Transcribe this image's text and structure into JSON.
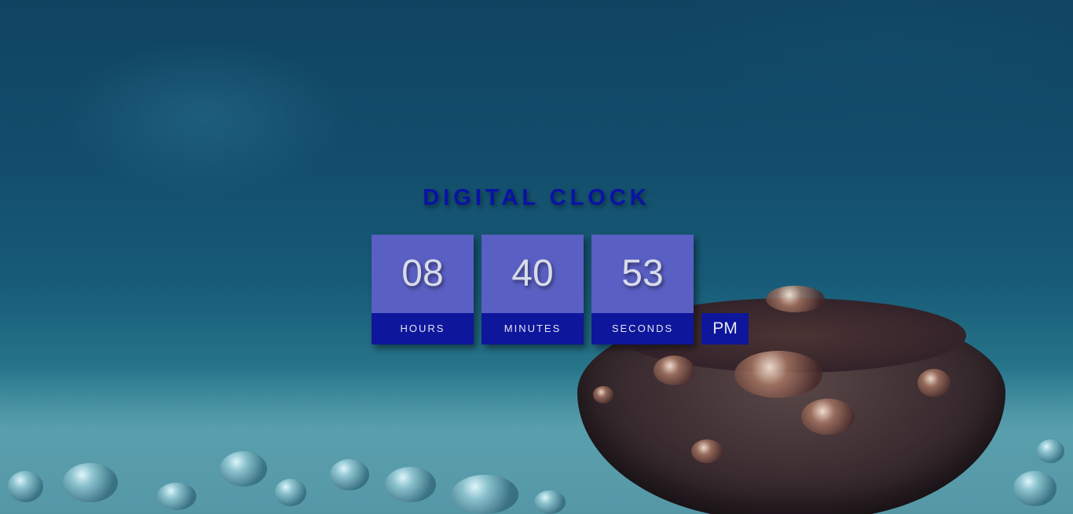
{
  "clock": {
    "title": "DIGITAL CLOCK",
    "hours": "08",
    "minutes": "40",
    "seconds": "53",
    "hours_label": "HOURS",
    "minutes_label": "MINUTES",
    "seconds_label": "SECONDS",
    "period": "PM"
  },
  "colors": {
    "title": "#0a12a6",
    "digit_box": "#5a5fc3",
    "label_bar": "#0e169b",
    "digit_text": "#d9dce8"
  }
}
